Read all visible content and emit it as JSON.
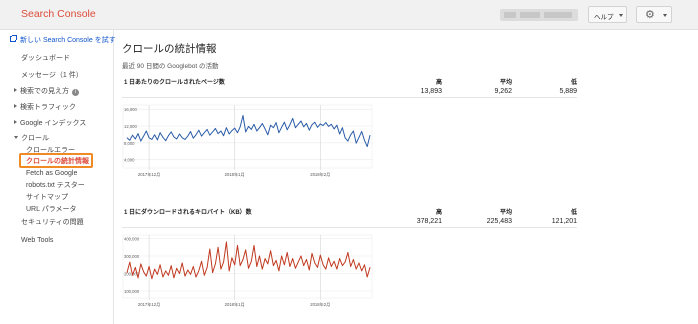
{
  "header": {
    "brand": "Search Console",
    "help_label": "ヘルプ",
    "icons": {
      "settings": "gear-icon",
      "dropdown": "chevron-down-icon"
    }
  },
  "sidebar": {
    "new_console_link": "新しい Search Console を試す",
    "items": [
      {
        "label": "ダッシュボード"
      },
      {
        "label": "メッセージ（1 件）"
      },
      {
        "label": "検索での見え方"
      },
      {
        "label": "検索トラフィック"
      },
      {
        "label": "Google インデックス"
      },
      {
        "label": "クロール"
      },
      {
        "label": "クロールエラー"
      },
      {
        "label": "クロールの統計情報"
      },
      {
        "label": "Fetch as Google"
      },
      {
        "label": "robots.txt テスター"
      },
      {
        "label": "サイトマップ"
      },
      {
        "label": "URL パラメータ"
      },
      {
        "label": "セキュリティの問題"
      },
      {
        "label": "Web Tools"
      }
    ],
    "info_icon": "i"
  },
  "main": {
    "title": "クロールの統計情報",
    "subtitle": "最近 90 日間の Googlebot の活動",
    "stat_headers": {
      "high": "高",
      "avg": "平均",
      "low": "低"
    },
    "colors": {
      "pages_series": "#2a5ca8",
      "kb_series": "#c0391f",
      "highlight": "#f08a24"
    }
  },
  "chart_data": [
    {
      "type": "line",
      "title": "1 日あたりのクロールされたページ数",
      "stats": {
        "high": "13,893",
        "avg": "9,262",
        "low": "5,889"
      },
      "y_ticks": [
        "16,000",
        "12,000",
        "8,000",
        "4,000"
      ],
      "ylim": [
        2000,
        17000
      ],
      "x_ticks": [
        "2017年12月",
        "2018年1月",
        "2018年2月"
      ],
      "values": [
        9200,
        8600,
        9800,
        8900,
        10200,
        8400,
        9600,
        10800,
        9200,
        8800,
        9900,
        8700,
        10400,
        9300,
        8500,
        9700,
        10600,
        9400,
        8900,
        10100,
        9200,
        8800,
        9600,
        10700,
        9100,
        9900,
        11000,
        9600,
        10400,
        11200,
        9800,
        10600,
        11400,
        10200,
        10800,
        9700,
        11600,
        10100,
        10900,
        11500,
        10400,
        11800,
        14500,
        10600,
        11900,
        11200,
        12400,
        10800,
        11600,
        12600,
        11300,
        9900,
        12200,
        11600,
        12800,
        10400,
        11700,
        12900,
        11100,
        12300,
        13800,
        11600,
        12400,
        13200,
        11800,
        12600,
        11000,
        12300,
        12900,
        11700,
        12500,
        12100,
        12800,
        11900,
        12400,
        11300,
        12200,
        10100,
        11600,
        9200,
        8400,
        9900,
        10800,
        7900,
        9300,
        10700,
        8600,
        7100,
        9800
      ]
    },
    {
      "type": "line",
      "title": "1 日にダウンロードされるキロバイト（KB）数",
      "stats": {
        "high": "378,221",
        "avg": "225,483",
        "low": "121,201"
      },
      "y_ticks": [
        "400,000",
        "300,000",
        "200,000",
        "100,000"
      ],
      "ylim": [
        60000,
        420000
      ],
      "x_ticks": [
        "2017年12月",
        "2018年1月",
        "2018年2月"
      ],
      "values": [
        205000,
        265000,
        190000,
        235000,
        175000,
        255000,
        210000,
        185000,
        240000,
        170000,
        225000,
        195000,
        250000,
        180000,
        215000,
        190000,
        245000,
        175000,
        230000,
        200000,
        260000,
        185000,
        220000,
        195000,
        240000,
        180000,
        215000,
        270000,
        190000,
        235000,
        340000,
        205000,
        255000,
        350000,
        225000,
        265000,
        380000,
        215000,
        290000,
        250000,
        360000,
        245000,
        280000,
        335000,
        230000,
        270000,
        360000,
        240000,
        300000,
        225000,
        285000,
        255000,
        330000,
        245000,
        275000,
        215000,
        300000,
        250000,
        320000,
        240000,
        285000,
        230000,
        265000,
        300000,
        245000,
        280000,
        220000,
        315000,
        260000,
        235000,
        305000,
        250000,
        225000,
        290000,
        240000,
        270000,
        225000,
        285000,
        245000,
        265000,
        320000,
        240000,
        280000,
        225000,
        260000,
        215000,
        250000,
        180000,
        235000
      ]
    }
  ]
}
